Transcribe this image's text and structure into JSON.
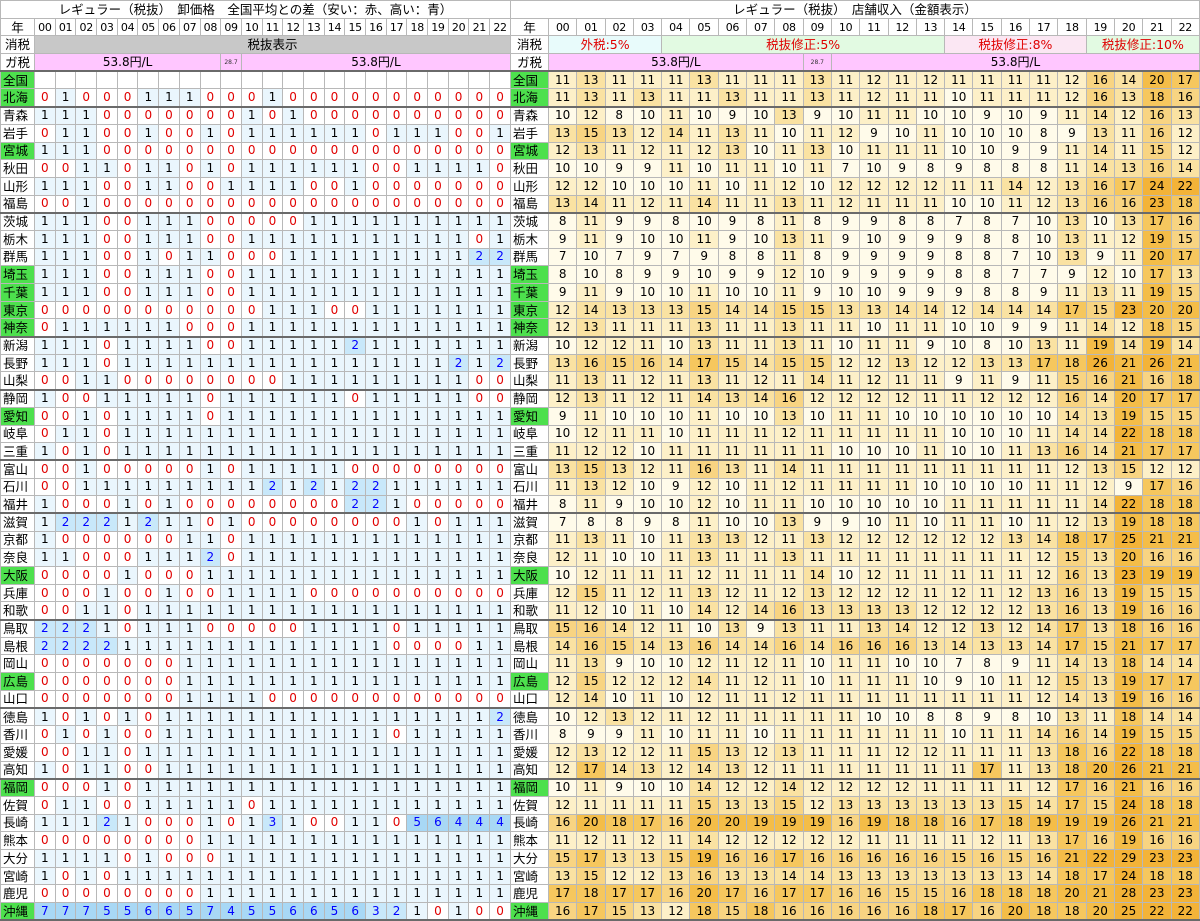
{
  "left": {
    "title": "レギュラー（税抜）　卸価格　全国平均との差（安い：赤、高い：青）",
    "year_label": "年",
    "tax_row_label": "消税",
    "tax_text": "税抜表示",
    "gas_row_label": "ガ税",
    "gas_tax_a": "53.8円/L",
    "gas_tax_small": "28.7",
    "gas_tax_b": "53.8円/L",
    "zenkoku_label": "全国"
  },
  "right": {
    "title": "レギュラー（税抜）　店舗収入（金額表示）",
    "year_label": "年",
    "tax_row_label": "消税",
    "tax_5_outer": "外税:5%",
    "tax_5_adj": "税抜修正:5%",
    "tax_8": "税抜修正:8%",
    "tax_10": "税抜修正:10%",
    "gas_row_label": "ガ税",
    "gas_tax_a": "53.8円/L",
    "gas_tax_small": "28.7",
    "gas_tax_b": "53.8円/L",
    "zenkoku_label": "全国"
  },
  "years": [
    "00",
    "01",
    "02",
    "03",
    "04",
    "05",
    "06",
    "07",
    "08",
    "09",
    "10",
    "11",
    "12",
    "13",
    "14",
    "15",
    "16",
    "17",
    "18",
    "19",
    "20",
    "21",
    "22"
  ],
  "zenkoku_margin": [
    "11",
    "13",
    "11",
    "11",
    "11",
    "13",
    "11",
    "11",
    "11",
    "13",
    "11",
    "12",
    "11",
    "12",
    "11",
    "11",
    "11",
    "11",
    "12",
    "16",
    "14",
    "20",
    "17"
  ],
  "colors": {
    "green": "#4de04d",
    "pink": "#ffc6ff",
    "red": "#e00000",
    "blue": "#0000ff",
    "light_blue": "#d8f0fb",
    "orange": "#f3b338"
  },
  "prefs": [
    {
      "name": "北海",
      "green": true,
      "diff": "0 1 0 0 0 1 1 1 0 0 0 1 0 0 0 0 0 0 0 0 0 0 0",
      "margin": "11 13 11 13 11 11 13 11 11 13 11 12 11 11 10 11 11 11 12 16 13 18 16"
    },
    {
      "name": "青森",
      "diff": "1 1 1 0 0 0 0 0 0 0 1 0 1 0 0 0 0 0 0 0 0 0 0",
      "margin": "10 12 8 10 11 10 9 10 13 9 10 11 11 10 10 9 10 9 11 14 12 16 13"
    },
    {
      "name": "岩手",
      "diff": "0 1 1 0 0 1 0 0 1 0 1 1 1 1 1 1 0 1 1 1 0 0 1",
      "margin": "13 15 13 12 14 11 13 11 10 11 12 9 10 11 10 10 10 8 9 13 11 16 12"
    },
    {
      "name": "宮城",
      "green": true,
      "diff": "1 1 1 0 0 0 0 0 0 0 0 0 0 0 0 0 0 0 0 0 0 0 0",
      "margin": "12 13 11 12 11 12 13 10 11 13 10 11 11 11 10 10 9 9 11 14 11 15 12"
    },
    {
      "name": "秋田",
      "diff": "0 0 1 1 0 1 1 0 1 0 1 1 1 1 1 1 0 0 1 1 1 1 0",
      "margin": "10 10 9 9 11 10 11 11 10 11 7 10 9 8 9 8 8 8 11 14 13 16 14"
    },
    {
      "name": "山形",
      "diff": "1 1 1 0 0 1 1 0 0 1 1 1 1 0 0 1 0 0 0 0 0 0 0",
      "margin": "12 12 10 10 10 11 10 11 12 10 12 12 12 12 11 11 14 12 13 16 17 24 22"
    },
    {
      "name": "福島",
      "diff": "0 0 1 0 0 0 0 0 0 0 0 0 0 0 0 0 0 0 0 0 0 0 0",
      "margin": "13 14 11 12 11 14 11 11 13 11 12 11 11 11 10 10 11 12 13 16 16 23 18"
    },
    {
      "name": "茨城",
      "diff": "1 1 1 0 0 1 1 1 0 0 0 0 0 1 1 1 1 1 1 1 1 1 1",
      "margin": "8 11 9 9 8 10 9 8 11 8 9 9 8 8 7 8 7 10 13 10 13 17 16"
    },
    {
      "name": "栃木",
      "diff": "1 1 1 0 0 1 1 1 0 0 1 1 1 1 1 1 1 1 1 1 1 0 1",
      "margin": "9 11 9 10 10 11 9 10 13 11 9 10 9 9 9 8 8 10 13 11 12 19 15"
    },
    {
      "name": "群馬",
      "diff": "1 1 1 0 0 1 0 1 1 0 0 0 1 1 1 1 1 1 1 1 1 2 2",
      "margin": "7 10 7 9 7 9 8 8 11 8 9 9 9 9 8 8 7 10 13 9 11 20 17"
    },
    {
      "name": "埼玉",
      "green": true,
      "diff": "1 1 1 0 0 1 1 1 0 0 1 1 1 1 1 1 1 1 1 1 1 1 1",
      "margin": "8 10 8 9 9 10 9 9 12 10 9 9 9 9 8 8 7 7 9 12 10 17 13"
    },
    {
      "name": "千葉",
      "green": true,
      "diff": "1 1 1 0 0 1 1 1 0 0 1 1 1 1 1 1 1 1 1 1 1 1 1",
      "margin": "9 11 9 10 10 11 10 10 11 9 10 10 9 9 9 8 8 9 11 13 11 19 15"
    },
    {
      "name": "東京",
      "green": true,
      "diff": "0 0 0 0 0 0 0 0 0 0 0 1 1 1 0 0 1 1 1 1 1 1 1",
      "margin": "12 14 13 13 13 15 14 14 15 15 13 13 14 14 12 14 14 14 17 15 23 20 20"
    },
    {
      "name": "神奈",
      "green": true,
      "diff": "0 1 1 1 1 1 1 0 0 0 1 1 1 1 1 1 1 1 1 1 1 1 1",
      "margin": "12 13 11 11 11 13 11 11 13 11 11 10 11 11 10 10 9 9 11 14 12 18 15"
    },
    {
      "name": "新潟",
      "diff": "1 1 1 0 1 1 1 1 0 0 1 1 1 1 1 2 1 1 1 1 1 1 1",
      "margin": "10 12 12 11 10 13 11 11 13 11 10 11 11 9 10 8 10 13 11 19 14 19 14"
    },
    {
      "name": "長野",
      "diff": "1 1 1 0 1 1 1 1 1 1 1 1 1 1 1 1 1 1 1 1 2 1 2",
      "margin": "13 16 15 16 14 17 15 14 15 15 12 12 13 12 12 13 13 17 18 26 21 26 21"
    },
    {
      "name": "山梨",
      "diff": "0 0 1 1 0 0 0 0 0 0 0 0 1 1 1 1 1 1 1 1 1 0 0",
      "margin": "11 13 11 12 11 13 11 12 11 14 11 12 11 11 9 11 9 11 15 16 21 16 18"
    },
    {
      "name": "静岡",
      "diff": "1 0 0 1 1 1 1 1 0 1 1 1 1 1 1 0 1 1 1 1 1 0 0",
      "margin": "12 13 11 12 11 14 13 14 16 12 12 12 12 11 11 12 12 12 16 14 20 17 17"
    },
    {
      "name": "愛知",
      "green": true,
      "diff": "0 0 1 0 1 1 1 1 0 1 1 1 1 1 1 1 1 1 1 1 1 1 1",
      "margin": "9 11 10 10 10 11 10 10 13 10 11 11 10 10 10 10 10 10 14 13 19 15 15"
    },
    {
      "name": "岐阜",
      "diff": "0 1 1 0 1 1 1 1 1 1 1 1 1 1 1 1 1 1 1 1 1 1 1",
      "margin": "10 12 11 11 10 11 11 11 12 11 11 11 11 11 10 10 10 11 14 14 22 18 18"
    },
    {
      "name": "三重",
      "diff": "1 0 1 0 1 1 1 1 1 1 1 1 1 1 1 1 1 1 1 1 1 1 1",
      "margin": "11 12 12 10 11 11 11 11 11 11 10 10 10 11 10 10 11 13 16 14 21 17 17"
    },
    {
      "name": "富山",
      "diff": "0 0 1 0 0 0 0 0 1 0 1 1 1 1 1 0 0 0 0 0 0 0 0",
      "margin": "13 15 13 12 11 16 13 11 14 11 11 11 11 11 11 11 11 11 12 13 15 12 12"
    },
    {
      "name": "石川",
      "diff": "0 0 1 1 1 1 1 1 1 1 1 2 1 2 1 2 2 1 1 1 1 1 1",
      "margin": "11 13 12 10 9 12 10 11 12 11 11 11 11 10 10 10 10 11 11 12 9 17 16"
    },
    {
      "name": "福井",
      "diff": "1 0 0 0 1 0 1 0 0 0 0 0 0 0 0 2 2 1 0 0 0 0 0",
      "margin": "8 11 9 10 10 12 10 11 11 10 10 10 10 10 11 11 11 11 11 14 22 18 18"
    },
    {
      "name": "滋賀",
      "diff": "1 2 2 2 1 2 1 1 0 1 0 0 0 0 0 0 0 0 1 0 1 1 1",
      "margin": "7 8 8 9 8 11 10 10 13 9 9 10 11 10 11 11 10 11 12 13 19 18 18"
    },
    {
      "name": "京都",
      "diff": "1 0 0 0 0 0 0 1 1 0 1 1 1 1 1 1 1 1 1 1 1 1 1",
      "margin": "11 13 11 10 11 13 13 12 11 13 12 12 12 12 12 12 13 14 18 17 25 21 21"
    },
    {
      "name": "奈良",
      "diff": "1 1 0 0 0 1 1 1 2 0 1 1 1 1 1 1 1 1 1 1 1 1 1",
      "margin": "12 11 10 10 11 13 11 11 13 11 11 11 11 11 11 11 11 12 15 13 20 16 16"
    },
    {
      "name": "大阪",
      "green": true,
      "diff": "0 0 0 0 1 0 0 0 1 1 1 1 1 1 1 1 1 1 1 1 1 1 1",
      "margin": "10 12 11 11 11 12 11 11 11 14 10 12 11 11 11 11 11 12 16 13 23 19 19"
    },
    {
      "name": "兵庫",
      "diff": "0 0 0 1 0 0 1 0 0 1 1 1 1 0 0 0 0 0 0 0 0 0 0",
      "margin": "12 15 11 12 11 13 12 11 12 13 12 12 12 11 12 11 12 13 16 13 19 15 15"
    },
    {
      "name": "和歌",
      "diff": "0 0 1 1 0 1 1 1 1 1 1 1 1 1 1 1 1 1 1 1 1 1 1",
      "margin": "11 12 10 11 10 14 12 14 16 13 13 13 13 12 12 12 12 13 16 13 19 16 16"
    },
    {
      "name": "鳥取",
      "diff": "2 2 2 1 0 1 1 1 0 0 0 0 0 1 1 1 1 0 1 1 1 1 1",
      "margin": "15 16 14 12 11 10 13 9 13 11 11 13 14 12 12 13 12 14 17 13 18 16 16"
    },
    {
      "name": "島根",
      "diff": "2 2 2 2 1 1 1 1 1 1 1 1 1 1 1 1 1 0 0 0 0 1 1",
      "margin": "14 16 15 14 13 16 14 14 16 14 16 16 16 13 14 13 13 14 17 15 21 17 17"
    },
    {
      "name": "岡山",
      "diff": "0 0 0 0 0 0 0 1 1 1 1 1 1 1 1 1 1 1 1 1 1 1 1",
      "margin": "11 13 9 10 10 12 11 12 11 10 11 11 10 10 7 8 9 11 14 13 18 14 14"
    },
    {
      "name": "広島",
      "green": true,
      "diff": "0 0 0 0 0 0 0 1 1 1 1 1 1 1 1 1 1 1 1 1 1 1 1",
      "margin": "12 15 12 12 12 14 11 12 11 10 11 11 11 10 9 10 11 12 15 13 19 17 17"
    },
    {
      "name": "山口",
      "diff": "0 0 0 0 0 0 0 1 1 1 1 0 0 0 0 0 0 0 0 0 0 0 0",
      "margin": "12 14 10 11 10 12 11 11 12 11 11 11 11 11 11 11 11 12 14 13 19 16 16"
    },
    {
      "name": "徳島",
      "diff": "1 0 1 0 1 0 1 1 1 1 1 1 1 1 1 1 1 1 1 1 1 1 2",
      "margin": "10 12 13 12 11 12 11 11 11 11 11 10 10 8 8 9 8 10 13 11 18 14 14"
    },
    {
      "name": "香川",
      "diff": "0 1 0 1 0 0 1 1 1 1 1 1 1 1 1 1 1 0 1 1 1 1 1",
      "margin": "8 9 9 11 10 11 11 10 11 11 11 11 11 11 10 11 11 14 16 14 19 15 15"
    },
    {
      "name": "愛媛",
      "diff": "0 0 1 1 0 1 1 1 1 1 1 1 1 1 1 1 1 1 1 1 1 1 1",
      "margin": "12 13 12 12 11 15 13 12 13 11 11 11 12 12 11 11 11 13 18 16 22 18 18"
    },
    {
      "name": "高知",
      "diff": "1 0 1 1 0 0 1 1 1 1 1 1 1 1 1 1 1 1 1 1 1 1 1",
      "margin": "12 17 14 13 12 14 13 12 11 11 11 11 11 11 11 17 11 13 18 20 26 21 21"
    },
    {
      "name": "福岡",
      "green": true,
      "diff": "0 0 0 1 0 1 1 1 1 1 1 1 1 1 1 1 1 1 1 1 1 1 1",
      "margin": "10 11 9 10 10 14 12 12 14 12 12 12 12 11 11 11 11 12 17 16 21 16 16"
    },
    {
      "name": "佐賀",
      "diff": "0 1 1 0 0 1 1 1 1 1 0 1 1 1 1 1 1 1 1 1 1 1 1",
      "margin": "12 11 11 11 11 15 13 13 15 12 13 13 13 13 13 13 15 14 17 15 24 18 18"
    },
    {
      "name": "長崎",
      "diff": "1 1 1 2 1 0 0 0 1 0 1 3 1 0 0 1 1 0 5 6 4 4 4",
      "margin": "16 20 18 17 16 20 20 19 19 19 16 19 18 18 16 17 18 19 19 19 26 21 21"
    },
    {
      "name": "熊本",
      "diff": "0 0 0 0 0 0 0 0 1 1 1 1 1 1 1 1 1 1 1 1 1 1 1",
      "margin": "11 12 11 12 11 14 12 12 12 12 12 11 11 11 11 12 11 13 17 16 19 16 16"
    },
    {
      "name": "大分",
      "diff": "1 1 1 1 0 1 0 0 0 1 1 1 1 1 1 1 1 1 1 1 1 1 1",
      "margin": "15 17 13 13 15 19 16 16 17 16 16 16 16 16 15 16 15 16 21 22 29 23 23"
    },
    {
      "name": "宮崎",
      "diff": "1 0 1 0 1 1 1 1 1 1 1 1 1 1 1 1 1 1 1 1 1 1 1",
      "margin": "13 15 12 12 13 16 13 13 14 14 13 13 13 13 13 13 13 14 18 17 24 18 18"
    },
    {
      "name": "鹿児",
      "diff": "0 0 0 0 0 0 0 0 1 1 1 1 1 1 1 1 1 1 1 1 1 1 1",
      "margin": "17 18 17 17 16 20 17 16 17 17 16 16 15 15 16 18 18 18 20 21 28 23 23"
    },
    {
      "name": "沖縄",
      "green": true,
      "diff": "7 7 7 5 5 6 6 5 7 4 5 5 6 6 5 6 3 2 1 0 1 0 0",
      "margin": "16 17 15 13 12 18 15 18 16 16 16 16 16 18 17 16 20 18 18 20 25 22 22"
    }
  ]
}
